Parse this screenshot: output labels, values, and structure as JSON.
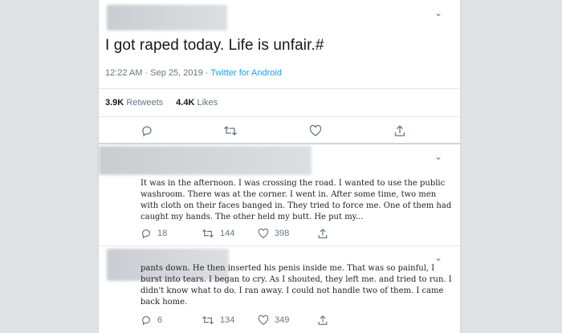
{
  "tweet": {
    "text": "I got raped today. Life is unfair.#",
    "time": "12:22 AM · Sep 25, 2019 · ",
    "source": "Twitter for Android",
    "retweets_count": "3.9K",
    "retweets_label": "Retweets",
    "likes_count": "4.4K",
    "likes_label": "Likes"
  },
  "replies": [
    {
      "text": "It was in the afternoon. I was crossing the road. I wanted to use the public washroom. There was at the corner. I went in. After some time, two men with cloth on their faces banged in. They tried to force me. One of them had caught my hands. The other held my butt. He put my...",
      "replies": "18",
      "retweets": "144",
      "likes": "398"
    },
    {
      "text": "pants down. He then inserted his penis inside me. That was so painful, I burst into tears. I began to cry. As I shouted, they left me. and tried to run. I didn't know what to do. I ran away. I could not handle two of them. I came back home.",
      "replies": "6",
      "retweets": "134",
      "likes": "349"
    }
  ],
  "icons": {
    "more": "chevron-down-icon",
    "reply": "reply-icon",
    "retweet": "retweet-icon",
    "like": "heart-icon",
    "share": "share-icon"
  },
  "colors": {
    "link": "#1da1f2",
    "muted": "#657786",
    "text": "#14171a"
  }
}
